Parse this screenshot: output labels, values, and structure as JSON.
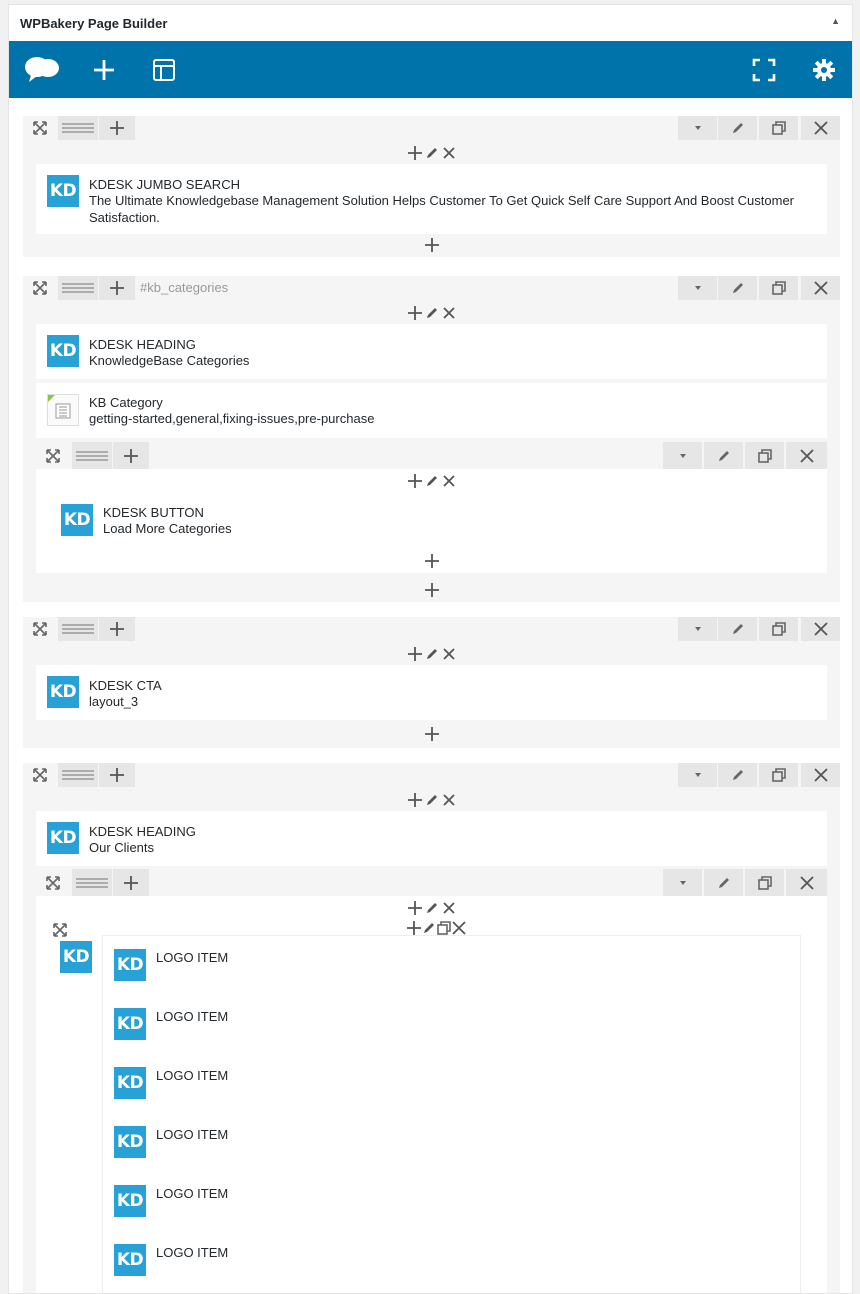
{
  "panel": {
    "title": "WPBakery Page Builder",
    "toggle_icon": "triangle-up-icon"
  },
  "toolbar": {
    "accent_color": "#0073aa",
    "left_icons": [
      "wpbakery-logo-icon",
      "add-element-icon",
      "templates-icon"
    ],
    "right_icons": [
      "fullscreen-icon",
      "settings-gear-icon"
    ]
  },
  "rows": [
    {
      "row_id": "",
      "elements": [
        {
          "icon_text": "KD",
          "title": "KDESK JUMBO SEARCH",
          "subtitle": "The Ultimate Knowledgebase Management Solution Helps Customer To Get Quick Self Care Support And Boost Customer Satisfaction."
        }
      ]
    },
    {
      "row_id": "#kb_categories",
      "elements": [
        {
          "icon_text": "KD",
          "title": "KDESK HEADING",
          "subtitle": "KnowledgeBase Categories"
        },
        {
          "icon": "kb-category-icon",
          "title": "KB Category",
          "subtitle": "getting-started,general,fixing-issues,pre-purchase"
        }
      ],
      "inner_row": {
        "elements": [
          {
            "icon_text": "KD",
            "title": "KDESK BUTTON",
            "subtitle": "Load More Categories"
          }
        ]
      }
    },
    {
      "row_id": "",
      "elements": [
        {
          "icon_text": "KD",
          "title": "KDESK CTA",
          "subtitle": "layout_3"
        }
      ]
    },
    {
      "row_id": "",
      "elements": [
        {
          "icon_text": "KD",
          "title": "KDESK HEADING",
          "subtitle": "Our Clients"
        }
      ],
      "inner_row": {
        "container_icon_text": "KD",
        "logo_items": [
          {
            "icon_text": "KD",
            "title": "LOGO ITEM"
          },
          {
            "icon_text": "KD",
            "title": "LOGO ITEM"
          },
          {
            "icon_text": "KD",
            "title": "LOGO ITEM"
          },
          {
            "icon_text": "KD",
            "title": "LOGO ITEM"
          },
          {
            "icon_text": "KD",
            "title": "LOGO ITEM"
          },
          {
            "icon_text": "KD",
            "title": "LOGO ITEM"
          }
        ]
      }
    }
  ]
}
